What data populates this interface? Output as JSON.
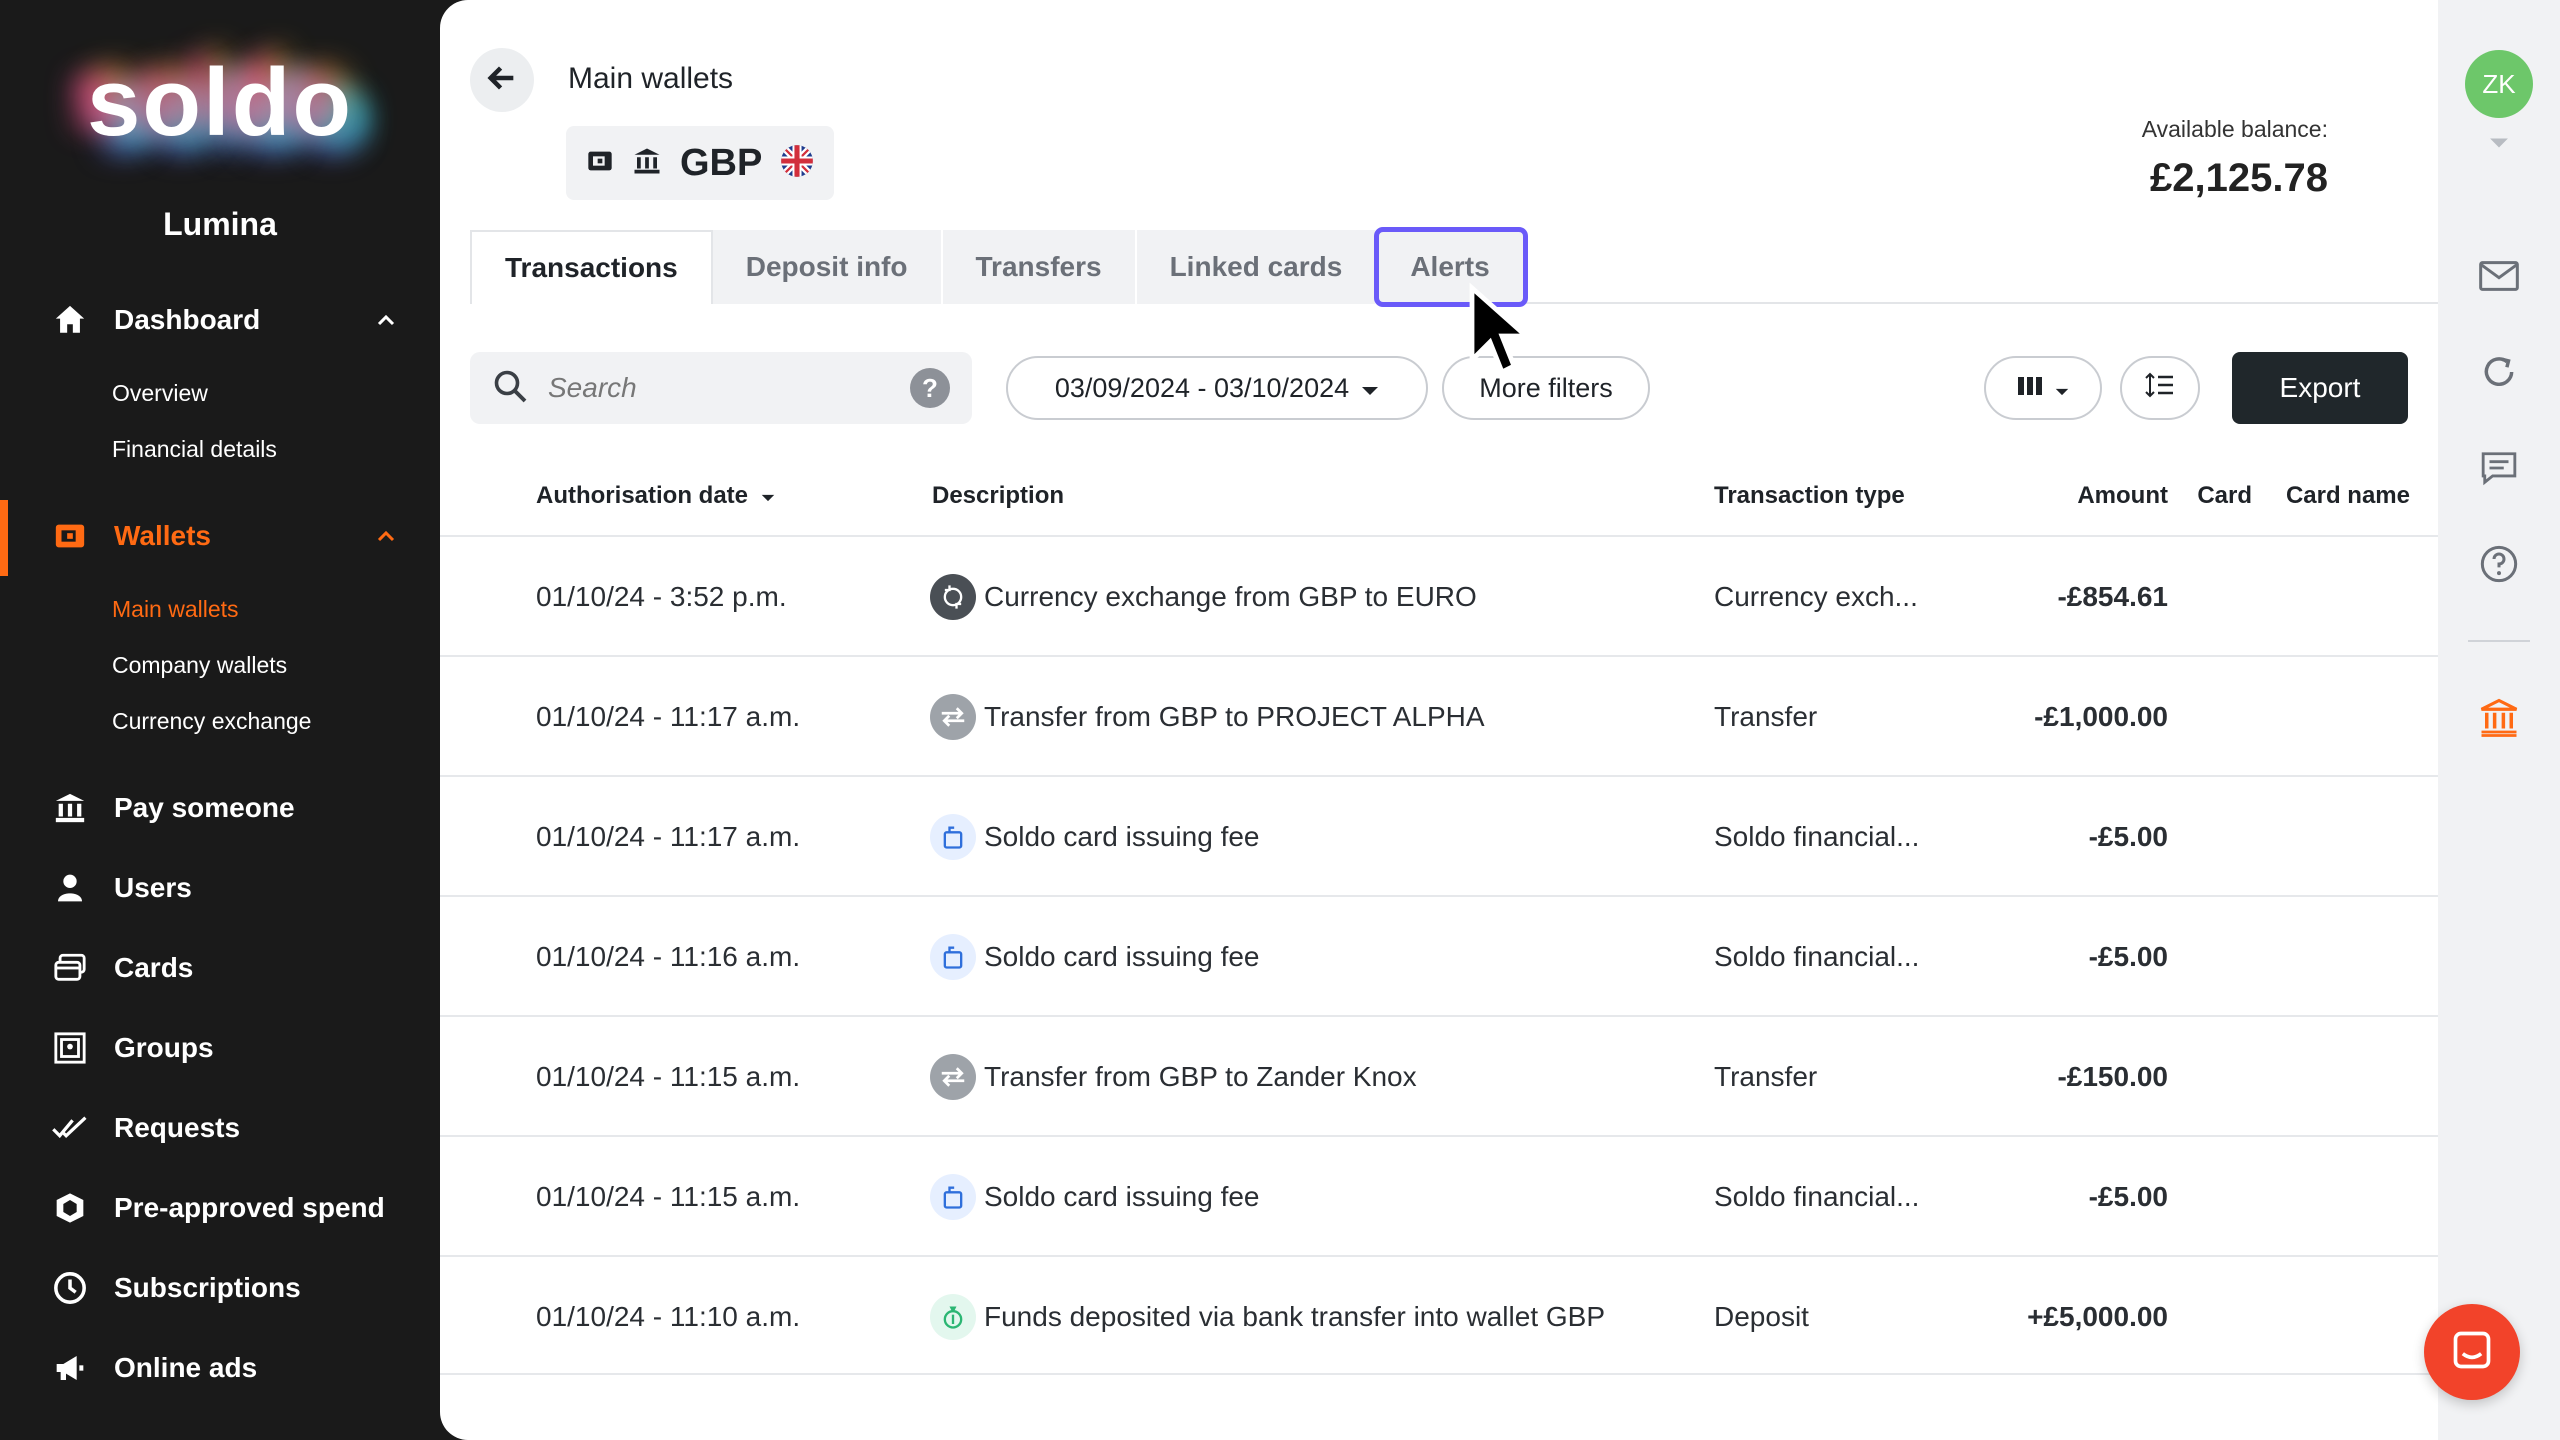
{
  "brand": {
    "logo": "soldo",
    "org": "Lumina"
  },
  "sidebar": {
    "items": [
      {
        "label": "Dashboard",
        "icon": "home-icon"
      },
      {
        "label": "Wallets",
        "icon": "wallet-icon"
      },
      {
        "label": "Pay someone",
        "icon": "bank-transfer-icon"
      },
      {
        "label": "Users",
        "icon": "user-icon"
      },
      {
        "label": "Cards",
        "icon": "cards-icon"
      },
      {
        "label": "Groups",
        "icon": "groups-icon"
      },
      {
        "label": "Requests",
        "icon": "double-check-icon"
      },
      {
        "label": "Pre-approved spend",
        "icon": "shield-icon"
      },
      {
        "label": "Subscriptions",
        "icon": "clock-icon"
      },
      {
        "label": "Online ads",
        "icon": "megaphone-icon"
      }
    ],
    "dashboard_sub": [
      "Overview",
      "Financial details"
    ],
    "wallets_sub": [
      "Main wallets",
      "Company wallets",
      "Currency exchange"
    ]
  },
  "header": {
    "title": "Main wallets",
    "currency": "GBP",
    "balance_label": "Available balance:",
    "balance_value": "£2,125.78"
  },
  "tabs": [
    "Transactions",
    "Deposit info",
    "Transfers",
    "Linked cards",
    "Alerts"
  ],
  "toolbar": {
    "search_placeholder": "Search",
    "help": "?",
    "date_range": "03/09/2024 - 03/10/2024",
    "more_filters": "More filters",
    "export": "Export"
  },
  "table": {
    "columns": [
      "Authorisation date",
      "Description",
      "Transaction type",
      "Amount",
      "Card",
      "Card name"
    ],
    "rows": [
      {
        "date": "01/10/24 - 3:52 p.m.",
        "description": "Currency exchange from GBP to EURO",
        "type": "Currency exch...",
        "amount": "-£854.61",
        "icon": "currency-exchange-icon"
      },
      {
        "date": "01/10/24 - 11:17 a.m.",
        "description": "Transfer from GBP to PROJECT ALPHA",
        "type": "Transfer",
        "amount": "-£1,000.00",
        "icon": "transfer-icon"
      },
      {
        "date": "01/10/24 - 11:17 a.m.",
        "description": "Soldo card issuing fee",
        "type": "Soldo financial...",
        "amount": "-£5.00",
        "icon": "fee-icon"
      },
      {
        "date": "01/10/24 - 11:16 a.m.",
        "description": "Soldo card issuing fee",
        "type": "Soldo financial...",
        "amount": "-£5.00",
        "icon": "fee-icon"
      },
      {
        "date": "01/10/24 - 11:15 a.m.",
        "description": "Transfer from GBP to Zander Knox",
        "type": "Transfer",
        "amount": "-£150.00",
        "icon": "transfer-icon"
      },
      {
        "date": "01/10/24 - 11:15 a.m.",
        "description": "Soldo card issuing fee",
        "type": "Soldo financial...",
        "amount": "-£5.00",
        "icon": "fee-icon"
      },
      {
        "date": "01/10/24 - 11:10 a.m.",
        "description": "Funds deposited via bank transfer into wallet GBP",
        "type": "Deposit",
        "amount": "+£5,000.00",
        "icon": "deposit-icon"
      }
    ]
  },
  "rail": {
    "avatar_initials": "ZK"
  },
  "colors": {
    "accent": "#ff6a13",
    "sidebar_bg": "#1a1a1a",
    "highlight": "#6a5af9",
    "avatar": "#6dc76a",
    "chat": "#f2432a"
  }
}
